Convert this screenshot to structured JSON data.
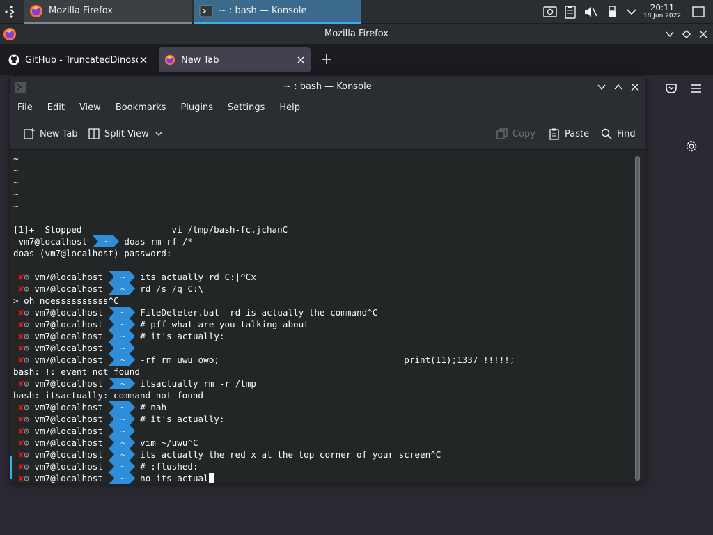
{
  "taskbar": {
    "tasks": [
      {
        "label": "Mozilla Firefox",
        "icon": "firefox-icon"
      },
      {
        "label": "~ : bash — Konsole",
        "icon": "konsole-icon"
      }
    ],
    "clock": {
      "time": "20:11",
      "date": "18 Jun 2022"
    }
  },
  "firefox": {
    "title": "Mozilla Firefox",
    "tabs": [
      {
        "label": "GitHub - TruncatedDinosour",
        "icon": "github-icon"
      },
      {
        "label": "New Tab",
        "icon": "firefox-icon"
      }
    ]
  },
  "konsole": {
    "title": "~ : bash — Konsole",
    "menu": [
      "File",
      "Edit",
      "View",
      "Bookmarks",
      "Plugins",
      "Settings",
      "Help"
    ],
    "toolbar": {
      "new_tab": "New Tab",
      "split_view": "Split View",
      "copy": "Copy",
      "paste": "Paste",
      "find": "Find"
    },
    "terminal": {
      "tilde_lines": [
        "~",
        "~",
        "~",
        "~",
        "~"
      ],
      "stopped_line": "[1]+  Stopped                 vi /tmp/bash-fc.jchanC",
      "prompt_user": "vm7@localhost",
      "prompt_dir": "~",
      "error_mark": "✘",
      "lines": [
        {
          "kind": "prompt",
          "err": false,
          "cmd": "doas rm rf /*"
        },
        {
          "kind": "out",
          "text": "doas (vm7@localhost) password:"
        },
        {
          "kind": "blank",
          "text": ""
        },
        {
          "kind": "prompt",
          "err": true,
          "cmd": "its actually rd C:|^Cx"
        },
        {
          "kind": "prompt",
          "err": true,
          "cmd": "rd /s /q C:\\"
        },
        {
          "kind": "out",
          "text": "> oh noessssssssss^C"
        },
        {
          "kind": "prompt",
          "err": true,
          "cmd": "FileDeleter.bat -rd is actually the command^C"
        },
        {
          "kind": "prompt",
          "err": true,
          "cmd": "# pff what are you talking about"
        },
        {
          "kind": "prompt",
          "err": true,
          "cmd": "# it's actually:"
        },
        {
          "kind": "prompt",
          "err": true,
          "cmd": ""
        },
        {
          "kind": "prompt",
          "err": true,
          "cmd": "-rf rm uwu owo;                                   print(11);1337 !!!!!;"
        },
        {
          "kind": "out",
          "text": "bash: !: event not found"
        },
        {
          "kind": "prompt",
          "err": true,
          "cmd": "itsactually rm -r /tmp"
        },
        {
          "kind": "out",
          "text": "bash: itsactually: command not found"
        },
        {
          "kind": "prompt",
          "err": true,
          "cmd": "# nah"
        },
        {
          "kind": "prompt",
          "err": true,
          "cmd": "# it's actually:"
        },
        {
          "kind": "prompt",
          "err": true,
          "cmd": ""
        },
        {
          "kind": "prompt",
          "err": true,
          "cmd": "vim ~/uwu^C"
        },
        {
          "kind": "prompt",
          "err": true,
          "cmd": "its actually the red x at the top corner of your screen^C"
        },
        {
          "kind": "prompt",
          "err": true,
          "cmd": "# :flushed:"
        },
        {
          "kind": "prompt",
          "err": true,
          "cmd": "no its actual"
        }
      ]
    }
  },
  "colors": {
    "prompt_arrow": "#2f8ed9",
    "error_mark": "#ed1515",
    "accent": "#3daee9"
  }
}
